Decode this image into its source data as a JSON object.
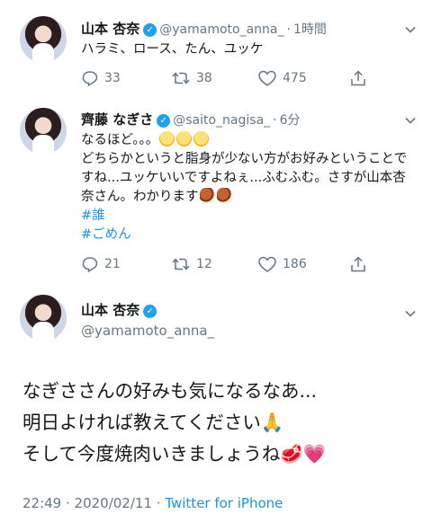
{
  "tweet1": {
    "name": "山本 杏奈",
    "handle": "@yamamoto_anna_",
    "sep": "·",
    "time": "1時間",
    "text": "ハラミ、ロース、たん、ユッケ",
    "reply_count": "33",
    "retweet_count": "38",
    "like_count": "475"
  },
  "tweet2": {
    "name": "齊藤 なぎさ",
    "handle": "@saito_nagisa_",
    "sep": "·",
    "time": "6分",
    "line1": "なるほど。。。",
    "line2": "どちらかというと脂身が少ない方がお好みということですね...ユッケいいですよねぇ...ふむふむ。さすが山本杏奈さん。わかります",
    "hashtag1": "#誰",
    "hashtag2": "#ごめん",
    "reply_count": "21",
    "retweet_count": "12",
    "like_count": "186"
  },
  "tweet3": {
    "name": "山本 杏奈",
    "handle": "@yamamoto_anna_",
    "line1": "なぎささんの好みも気になるなあ...",
    "line2": "明日よければ教えてください",
    "line3": "そして今度焼肉いきましょうね",
    "emoji1": "🙏",
    "emoji2": "🥩",
    "emoji3": "💗",
    "date": "22:49 · 2020/02/11 ·",
    "source": "Twitter for iPhone"
  },
  "icons": [
    "reply-icon",
    "retweet-icon",
    "like-icon",
    "share-icon",
    "chevron-down-icon",
    "verified-icon"
  ],
  "colors": {
    "link": "#1b95e0",
    "muted": "#657786",
    "verified": "#1da1f2"
  }
}
